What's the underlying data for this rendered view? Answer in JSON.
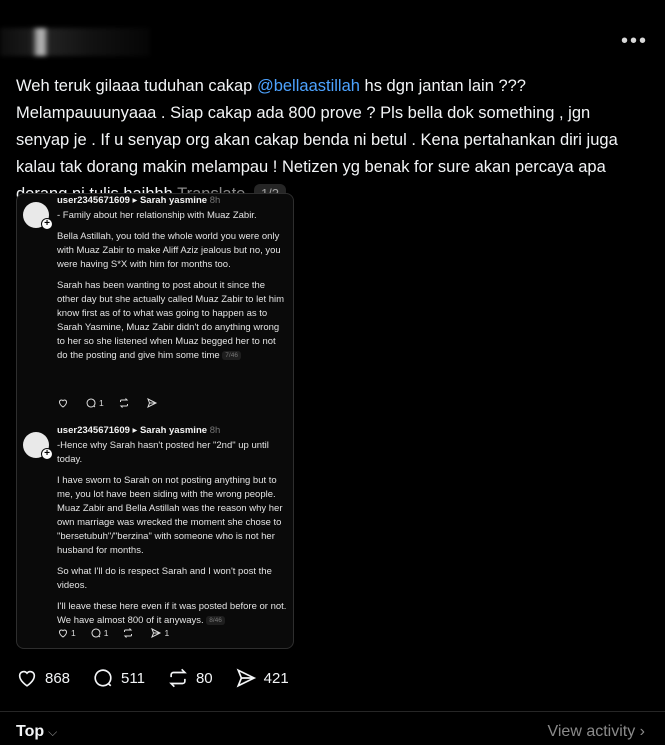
{
  "post": {
    "text_before_mention": "Weh teruk gilaaa tuduhan cakap ",
    "mention": "@bellaastillah",
    "text_after_mention": " hs dgn jantan lain ??? Melampauuunyaaa . Siap cakap ada 800 prove ? Pls bella dok something , jgn senyap je . If u senyap org akan cakap benda ni betul . Kena pertahankan diri juga kalau tak dorang makin melampau ! Netizen yg benak for sure akan percaya apa dorang ni tulis haihhh",
    "translate_label": "Translate",
    "image_page": "1/2"
  },
  "screenshot": {
    "replies": [
      {
        "username": "user2345671609",
        "reply_to": "Sarah yasmine",
        "time": "8h",
        "paragraphs": [
          "- Family about her relationship with Muaz Zabir.",
          "Bella Astillah, you told the whole world you were only with Muaz Zabir to make Aliff Aziz jealous but no, you were having S*X with him for months too.",
          "Sarah has been wanting to post about it since the other day but she actually called Muaz Zabir to let him know first as of to what was going to happen as to Sarah Yasmine, Muaz Zabir didn't do anything wrong to her so she listened when Muaz begged her to not do the posting and give him some time"
        ],
        "page_counter": "7/46",
        "likes": "",
        "replies_count": "1",
        "reposts": "",
        "shares": ""
      },
      {
        "username": "user2345671609",
        "reply_to": "Sarah yasmine",
        "time": "8h",
        "paragraphs": [
          "-Hence why Sarah hasn't posted her \"2nd\" up until today.",
          "I have sworn to Sarah on not posting anything but to me, you lot have been siding with the wrong people. Muaz Zabir and Bella Astillah was the reason why her own marriage was wrecked the moment she chose to \"bersetubuh\"/\"berzina\" with someone who is not her husband for months.",
          "So what I'll do is respect Sarah and I won't post the videos.",
          "I'll leave these here even if it was posted before or not. We have almost 800 of it anyways."
        ],
        "page_counter": "8/46",
        "likes": "1",
        "replies_count": "1",
        "reposts": "",
        "shares": "1"
      }
    ]
  },
  "actions": {
    "likes": "868",
    "replies": "511",
    "reposts": "80",
    "shares": "421"
  },
  "footer": {
    "sort_label": "Top",
    "view_activity_label": "View activity"
  },
  "icons": {
    "more": "more-horizontal-icon",
    "like": "heart-icon",
    "reply": "comment-bubble-icon",
    "repost": "repost-icon",
    "share": "send-icon"
  },
  "colors": {
    "background": "#000000",
    "text": "#f3f5f7",
    "mention": "#4da3ff",
    "muted": "#8a8a8a"
  }
}
